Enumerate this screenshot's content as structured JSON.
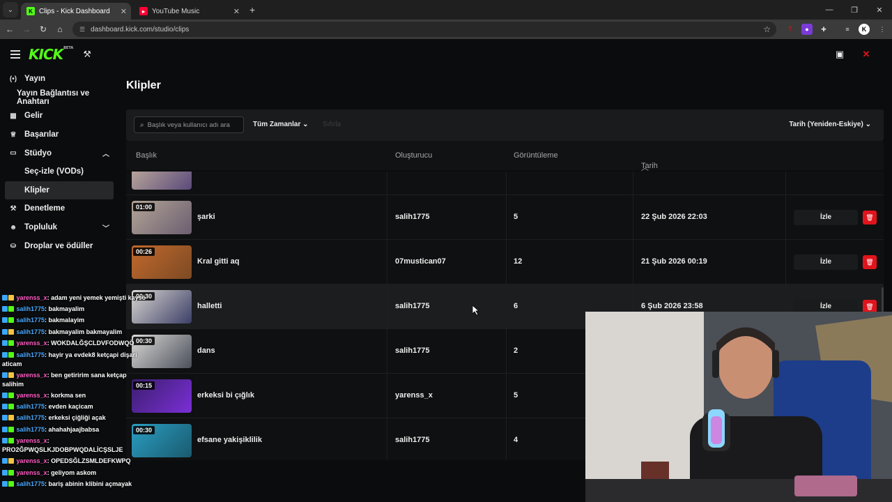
{
  "browser": {
    "tabs": [
      {
        "title": "Clips - Kick Dashboard",
        "active": true,
        "icon": "kick-favicon"
      },
      {
        "title": "YouTube Music",
        "active": false,
        "icon": "youtube-music-favicon"
      }
    ],
    "url": "dashboard.kick.com/studio/clips"
  },
  "app": {
    "logo": "KICK",
    "logo_badge": "BETA",
    "accent": "#53fc18"
  },
  "sidebar": {
    "items": [
      {
        "label": "Yayın",
        "icon": "broadcast-icon"
      },
      {
        "label": "Yayın Bağlantısı ve Anahtarı",
        "icon": ""
      },
      {
        "label": "Gelir",
        "icon": "revenue-icon"
      },
      {
        "label": "Başarılar",
        "icon": "trophy-icon"
      },
      {
        "label": "Stüdyo",
        "icon": "studio-icon",
        "expanded": true
      },
      {
        "label": "Seç-izle (VODs)",
        "icon": ""
      },
      {
        "label": "Klipler",
        "icon": "",
        "active": true
      },
      {
        "label": "Denetleme",
        "icon": "moderation-icon"
      },
      {
        "label": "Topluluk",
        "icon": "community-icon",
        "expanded": false
      },
      {
        "label": "Droplar ve ödüller",
        "icon": "drops-icon"
      }
    ]
  },
  "main": {
    "title": "Klipler",
    "search_placeholder": "Başlık veya kullanıcı adı ara",
    "time_filter": "Tüm Zamanlar",
    "reset_label": "Sıfırla",
    "sort_label": "Tarih (Yeniden-Eskiye)",
    "columns": {
      "title": "Başlık",
      "creator": "Oluşturucu",
      "views": "Görüntüleme",
      "date": "Tarih"
    },
    "watch_label": "İzle",
    "clips": [
      {
        "duration": "",
        "title": "",
        "creator": "",
        "views": "",
        "date": ""
      },
      {
        "duration": "01:00",
        "title": "şarki",
        "creator": "salih1775",
        "views": "5",
        "date": "22 Şub 2026 22:03"
      },
      {
        "duration": "00:26",
        "title": "Kral gitti aq",
        "creator": "07mustican07",
        "views": "12",
        "date": "21 Şub 2026 00:19"
      },
      {
        "duration": "00:30",
        "title": "halletti",
        "creator": "salih1775",
        "views": "6",
        "date": "6 Şub 2026 23:58"
      },
      {
        "duration": "00:30",
        "title": "dans",
        "creator": "salih1775",
        "views": "2",
        "date": ""
      },
      {
        "duration": "00:15",
        "title": "erkeksi bi çığlık",
        "creator": "yarenss_x",
        "views": "5",
        "date": ""
      },
      {
        "duration": "00:30",
        "title": "efsane yakişiklilik",
        "creator": "salih1775",
        "views": "4",
        "date": ""
      }
    ]
  },
  "chat": [
    {
      "user": "yarenss_x",
      "text": "adam yeni yemek yemişti kayso",
      "color": "pink",
      "wrap": true
    },
    {
      "user": "salih1775",
      "text": "bakmayalim",
      "color": "blue"
    },
    {
      "user": "salih1775",
      "text": "bakmalayim",
      "color": "blue"
    },
    {
      "user": "salih1775",
      "text": "bakmayalim bakmayalim",
      "color": "blue"
    },
    {
      "user": "yarenss_x",
      "text": "WOKDALĞŞCLDVFODWQÖ",
      "color": "pink"
    },
    {
      "user": "salih1775",
      "text": "hayir ya evdek8 ketçapi dişari aticam",
      "color": "blue",
      "wrap": true
    },
    {
      "user": "yarenss_x",
      "text": "ben getiririm sana ketçap salihim",
      "color": "pink",
      "wrap": true
    },
    {
      "user": "yarenss_x",
      "text": "korkma sen",
      "color": "pink"
    },
    {
      "user": "salih1775",
      "text": "evden kaçicam",
      "color": "blue"
    },
    {
      "user": "salih1775",
      "text": "erkeksi çiğliği açak",
      "color": "blue"
    },
    {
      "user": "salih1775",
      "text": "ahahahjaajbabsa",
      "color": "blue"
    },
    {
      "user": "yarenss_x",
      "text": "PRO2ĞPWQSLKJDOBPWQDALİCŞSLJE",
      "color": "pink",
      "wrap": true
    },
    {
      "user": "yarenss_x",
      "text": "OPEDSĞLZSMLDEFKWPQ",
      "color": "pink"
    },
    {
      "user": "yarenss_x",
      "text": "geliyom askom",
      "color": "pink"
    },
    {
      "user": "salih1775",
      "text": "bariş abinin klibini açmayak",
      "color": "blue"
    }
  ]
}
